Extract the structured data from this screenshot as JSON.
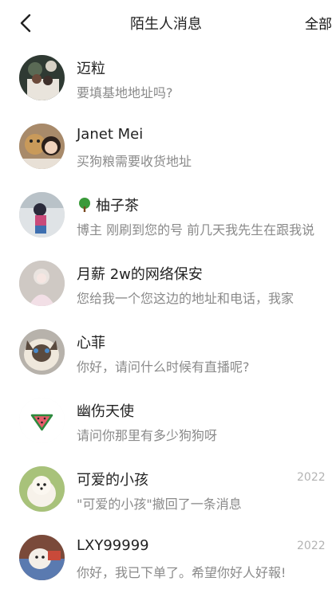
{
  "header": {
    "title": "陌生人消息",
    "right_link": "全部"
  },
  "messages": [
    {
      "name": "迈粒",
      "preview": "要填基地地址吗?",
      "time": ""
    },
    {
      "name": "Janet Mei",
      "preview": "买狗粮需要收货地址",
      "time": ""
    },
    {
      "name": "柚子茶",
      "name_icon": "tree-emoji-icon",
      "preview": "博主 刚刷到您的号 前几天我先生在跟我说",
      "time": ""
    },
    {
      "name": "月薪 2w的网络保安",
      "preview": "您给我一个您这边的地址和电话，我家",
      "time": ""
    },
    {
      "name": "心菲",
      "preview": "你好，请问什么时候有直播呢?",
      "time": ""
    },
    {
      "name": "幽伤天使",
      "preview": "请问你那里有多少狗狗呀",
      "time": ""
    },
    {
      "name": "可爱的小孩",
      "preview": "\"可爱的小孩\"撤回了一条消息",
      "time": "2022"
    },
    {
      "name": "LXY99999",
      "preview": "你好，我已下单了。希望你好人好報!",
      "time": "2022"
    }
  ]
}
